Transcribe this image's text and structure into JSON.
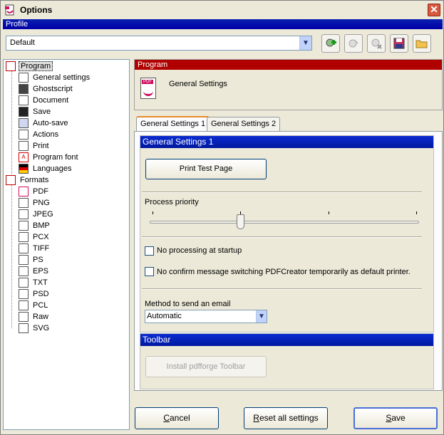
{
  "window": {
    "title": "Options",
    "close_symbol": "✕"
  },
  "profile": {
    "header": "Profile",
    "selected": "Default",
    "toolbar_icons": [
      "add-profile-icon",
      "rename-profile-icon",
      "delete-profile-icon",
      "save-profile-icon",
      "open-profile-icon"
    ]
  },
  "tree": {
    "program": {
      "label": "Program",
      "children": [
        "General settings",
        "Ghostscript",
        "Document",
        "Save",
        "Auto-save",
        "Actions",
        "Print",
        "Program font",
        "Languages"
      ]
    },
    "formats": {
      "label": "Formats",
      "children": [
        "PDF",
        "PNG",
        "JPEG",
        "BMP",
        "PCX",
        "TIFF",
        "PS",
        "EPS",
        "TXT",
        "PSD",
        "PCL",
        "Raw",
        "SVG"
      ]
    }
  },
  "panel": {
    "header": "Program",
    "title": "General Settings",
    "icon_text": "PDF"
  },
  "tabs": [
    {
      "label": "General Settings 1",
      "active": true
    },
    {
      "label": "General Settings 2",
      "active": false
    }
  ],
  "general": {
    "header": "General Settings 1",
    "print_test_page": "Print Test Page",
    "process_priority_label": "Process priority",
    "process_priority_level": 0.33,
    "no_processing_label": "No processing at startup",
    "no_processing_checked": false,
    "no_confirm_label": "No confirm message switching PDFCreator temporarily as default printer.",
    "no_confirm_checked": false,
    "email_method_label": "Method to send an email",
    "email_method_value": "Automatic"
  },
  "toolbar_group": {
    "header": "Toolbar",
    "install_button": "Install pdfforge Toolbar"
  },
  "footer": {
    "cancel": "Cancel",
    "reset": "Reset all settings",
    "save": "Save"
  }
}
